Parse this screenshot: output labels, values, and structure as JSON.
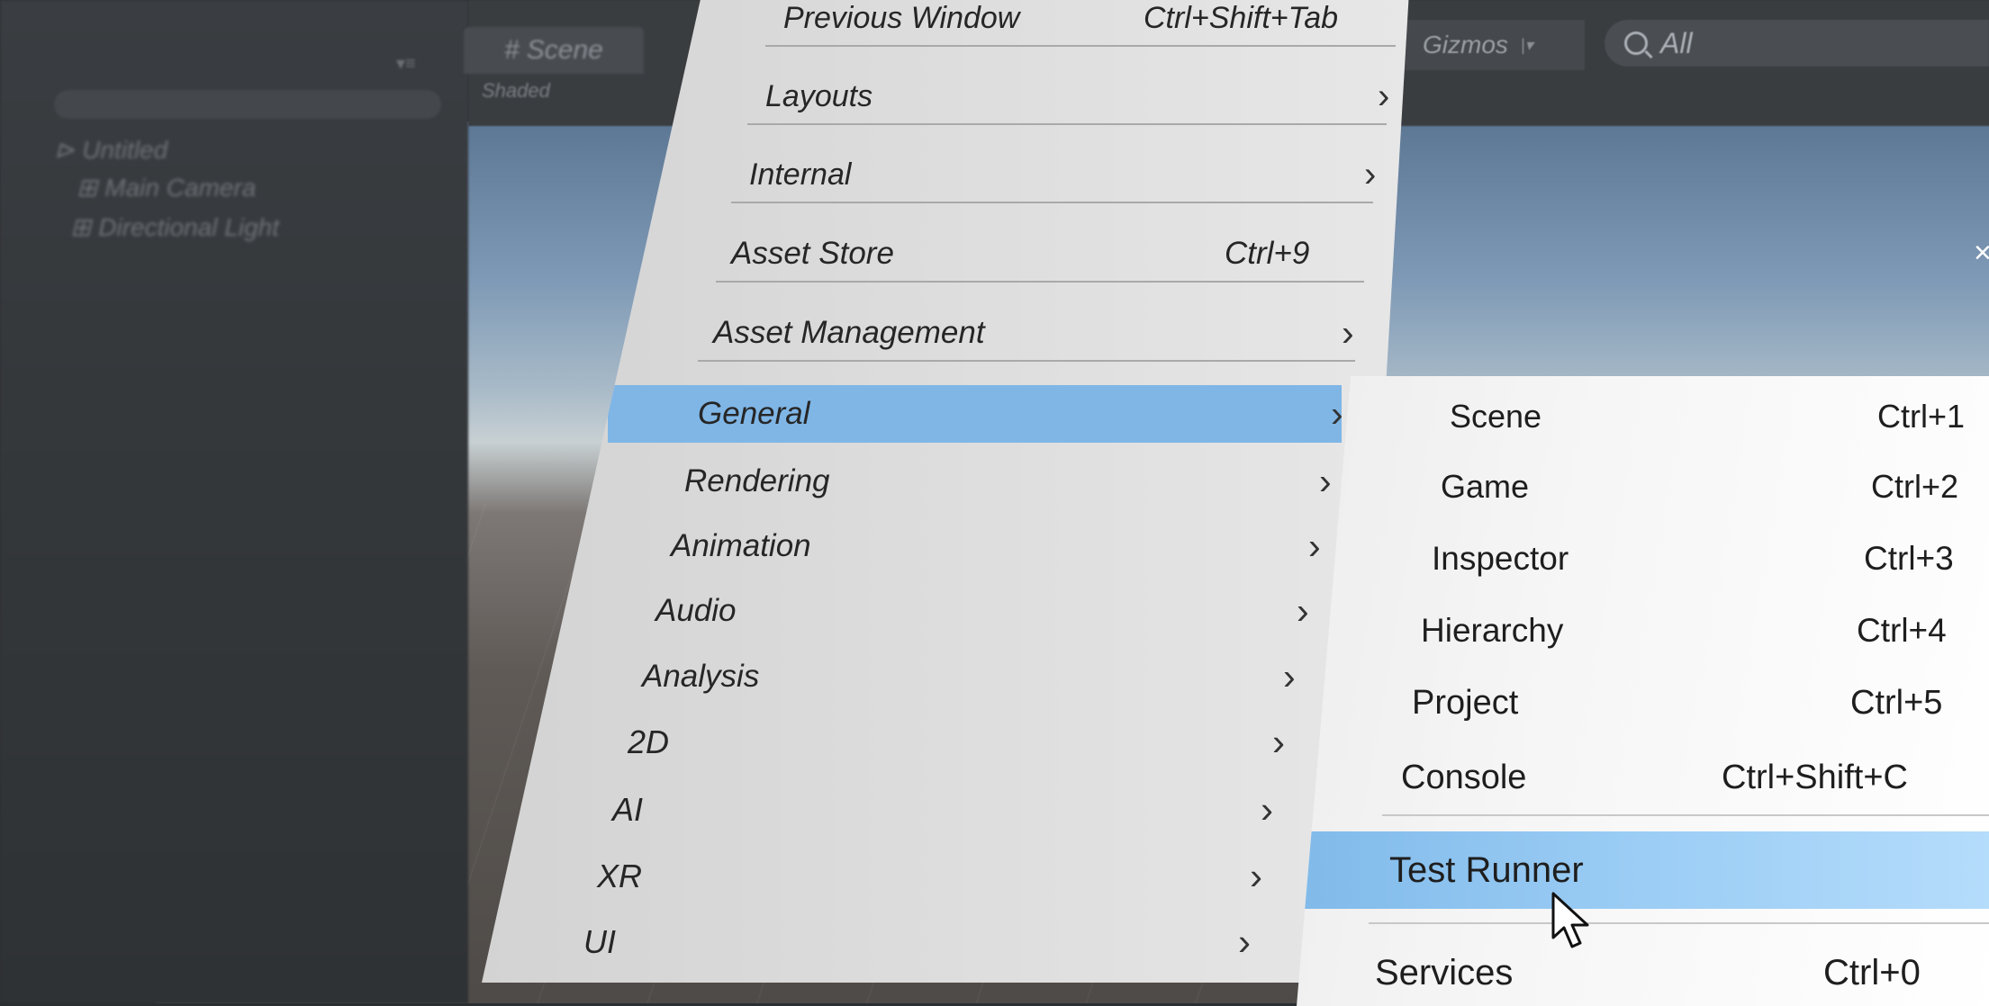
{
  "background": {
    "hierarchy": {
      "scene_name": "Untitled",
      "items": [
        "Main Camera",
        "Directional Light"
      ]
    },
    "scene_view": {
      "tab_label": "Scene",
      "shading_mode": "Shaded",
      "gizmos_label": "Gizmos",
      "search_text": "All",
      "icons": [
        "hash-icon",
        "search-icon",
        "dropdown-arrow-icon",
        "close-icon"
      ]
    }
  },
  "window_menu": {
    "items": [
      {
        "label": "Previous Window",
        "shortcut": "Ctrl+Shift+Tab",
        "submenu": false
      },
      {
        "label": "Layouts",
        "shortcut": "",
        "submenu": true
      },
      {
        "label": "Internal",
        "shortcut": "",
        "submenu": true
      },
      {
        "label": "Asset Store",
        "shortcut": "Ctrl+9",
        "submenu": false
      },
      {
        "label": "Asset Management",
        "shortcut": "",
        "submenu": true
      },
      {
        "label": "General",
        "shortcut": "",
        "submenu": true,
        "selected": true
      },
      {
        "label": "Rendering",
        "shortcut": "",
        "submenu": true
      },
      {
        "label": "Animation",
        "shortcut": "",
        "submenu": true
      },
      {
        "label": "Audio",
        "shortcut": "",
        "submenu": true
      },
      {
        "label": "Analysis",
        "shortcut": "",
        "submenu": true
      },
      {
        "label": "2D",
        "shortcut": "",
        "submenu": true
      },
      {
        "label": "AI",
        "shortcut": "",
        "submenu": true
      },
      {
        "label": "XR",
        "shortcut": "",
        "submenu": true
      },
      {
        "label": "UI",
        "shortcut": "",
        "submenu": true
      }
    ],
    "submenu_arrow": "›"
  },
  "general_submenu": {
    "items": [
      {
        "label": "Scene",
        "shortcut": "Ctrl+1"
      },
      {
        "label": "Game",
        "shortcut": "Ctrl+2"
      },
      {
        "label": "Inspector",
        "shortcut": "Ctrl+3"
      },
      {
        "label": "Hierarchy",
        "shortcut": "Ctrl+4"
      },
      {
        "label": "Project",
        "shortcut": "Ctrl+5"
      },
      {
        "label": "Console",
        "shortcut": "Ctrl+Shift+C"
      },
      {
        "label": "Test Runner",
        "shortcut": "",
        "selected": true
      },
      {
        "label": "Services",
        "shortcut": "Ctrl+0"
      }
    ]
  },
  "colors": {
    "selection": "#7fb6e6",
    "menu_bg": "#dedede",
    "submenu_bg": "#f6f6f6",
    "editor_bg": "#2b2e31"
  }
}
